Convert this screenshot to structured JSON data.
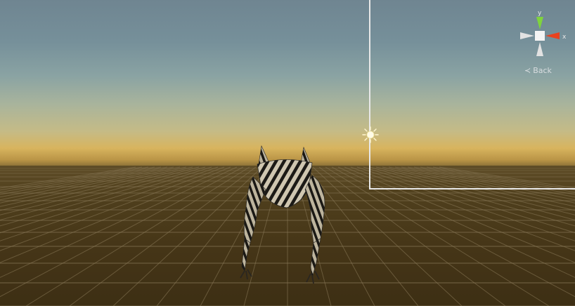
{
  "scene": {
    "sky_colors": {
      "top": "#6f8591",
      "horizon": "#d8b45e"
    },
    "ground_color": "#453517",
    "grid_line_color": "#8a7a5a"
  },
  "gizmo": {
    "y_label": "y",
    "x_label": "x",
    "y_axis_color": "#7fd43c",
    "x_axis_color": "#e8421f",
    "neutral_axis_color": "#e0e0e0"
  },
  "back_button": {
    "icon": "chevron-left-icon",
    "label": "Back"
  },
  "light": {
    "icon": "sun-icon"
  },
  "model": {
    "texture": "zebra-stripes"
  }
}
